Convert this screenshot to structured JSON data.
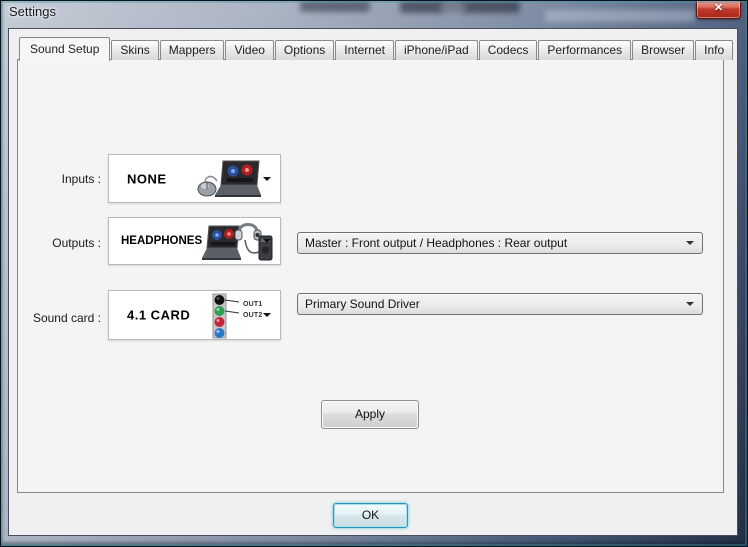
{
  "window": {
    "title": "Settings",
    "close_glyph": "✕"
  },
  "tabs": [
    {
      "label": "Sound Setup",
      "active": true
    },
    {
      "label": "Skins"
    },
    {
      "label": "Mappers"
    },
    {
      "label": "Video"
    },
    {
      "label": "Options"
    },
    {
      "label": "Internet"
    },
    {
      "label": "iPhone/iPad"
    },
    {
      "label": "Codecs"
    },
    {
      "label": "Performances"
    },
    {
      "label": "Browser"
    },
    {
      "label": "Info"
    }
  ],
  "sound_setup": {
    "inputs": {
      "label": "Inputs :",
      "selected": "NONE"
    },
    "outputs": {
      "label": "Outputs :",
      "selected": "HEADPHONES",
      "routing_selected": "Master : Front output / Headphones : Rear output"
    },
    "sound_card": {
      "label": "Sound card :",
      "selected": "4.1 CARD",
      "driver_selected": "Primary Sound Driver",
      "jack_out1": "OUT1",
      "jack_out2": "OUT2"
    },
    "apply_label": "Apply"
  },
  "footer": {
    "ok_label": "OK"
  },
  "colors": {
    "close_button_red": "#c03a2b",
    "ok_focus_border": "#2f93b4",
    "dialog_bg": "#f0f0f0",
    "selector_bg": "#ffffff"
  }
}
